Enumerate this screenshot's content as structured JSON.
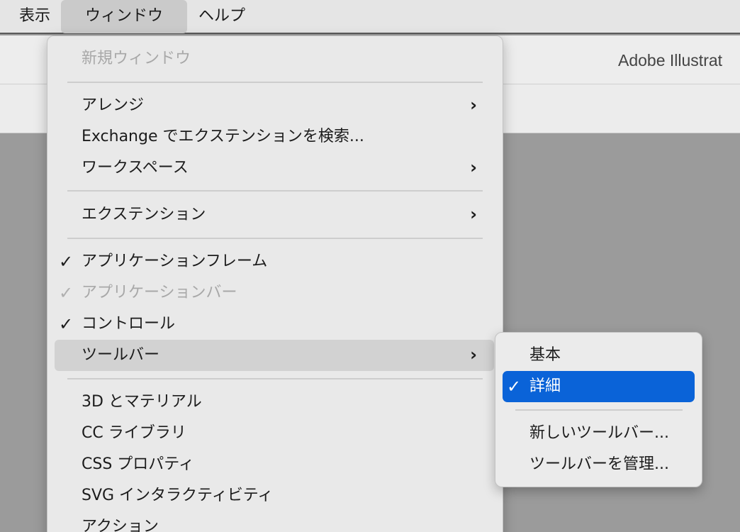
{
  "menubar": {
    "items": [
      {
        "label": "表示"
      },
      {
        "label": "ウィンドウ"
      },
      {
        "label": "ヘルプ"
      }
    ]
  },
  "app": {
    "title": "Adobe Illustrat"
  },
  "menu": {
    "items": [
      {
        "label": "新規ウィンドウ",
        "disabled": true
      },
      {
        "label": "アレンジ",
        "submenu": true
      },
      {
        "label": "Exchange でエクステンションを検索..."
      },
      {
        "label": "ワークスペース",
        "submenu": true
      },
      {
        "label": "エクステンション",
        "submenu": true
      },
      {
        "label": "アプリケーションフレーム",
        "checked": true
      },
      {
        "label": "アプリケーションバー",
        "checked": true,
        "disabled": true
      },
      {
        "label": "コントロール",
        "checked": true
      },
      {
        "label": "ツールバー",
        "submenu": true,
        "highlighted": true
      },
      {
        "label": "3D とマテリアル"
      },
      {
        "label": "CC ライブラリ"
      },
      {
        "label": "CSS プロパティ"
      },
      {
        "label": "SVG インタラクティビティ"
      },
      {
        "label": "アクション"
      }
    ],
    "check_glyph": "✓",
    "chevron_glyph": "›"
  },
  "submenu": {
    "items": [
      {
        "label": "基本"
      },
      {
        "label": "詳細",
        "checked": true,
        "selected": true
      },
      {
        "label": "新しいツールバー..."
      },
      {
        "label": "ツールバーを管理..."
      }
    ]
  },
  "colors": {
    "selection": "#0a63d8",
    "menu_bg": "#e9e9e9",
    "canvas": "#9b9b9b"
  }
}
